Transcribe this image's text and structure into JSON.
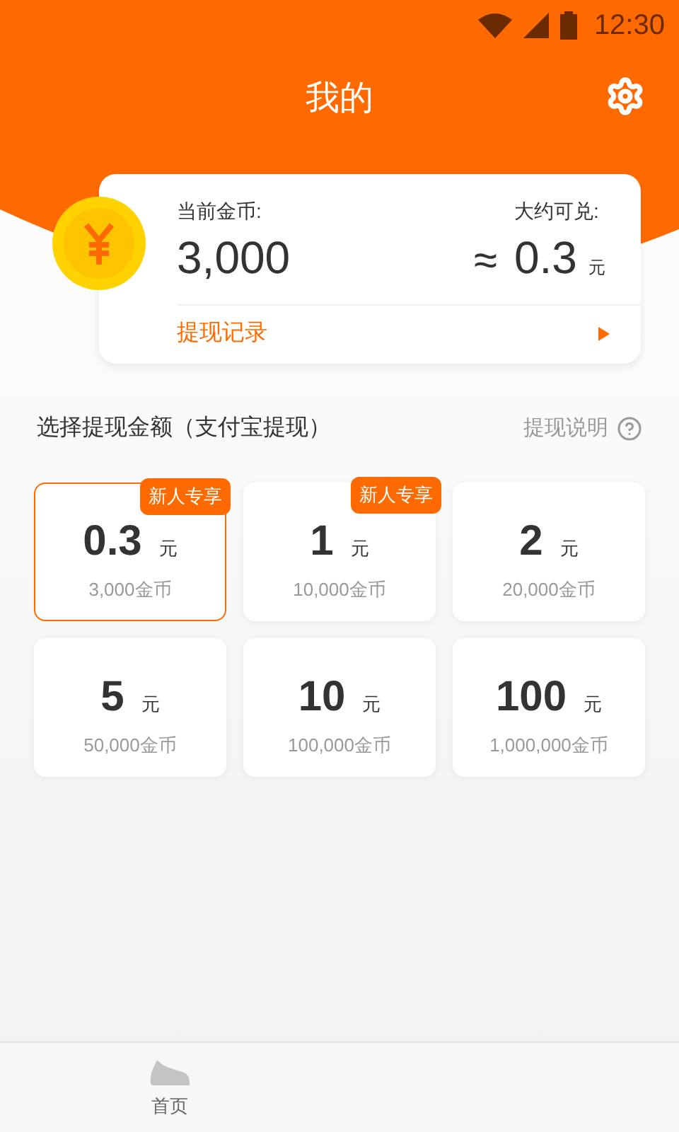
{
  "status_bar": {
    "time": "12:30"
  },
  "header": {
    "title": "我的"
  },
  "balance_card": {
    "coins_label": "当前金币:",
    "coins": "3,000",
    "approx_sign": "≈",
    "value_label": "大约可兑:",
    "value": "0.3",
    "value_unit": "元",
    "history_link": "提现记录"
  },
  "section": {
    "title": "选择提现金额（支付宝提现）",
    "help_link": "提现说明"
  },
  "options": [
    {
      "amount": "0.3",
      "unit": "元",
      "coins": "3,000金币",
      "badge": "新人专享",
      "selected": true
    },
    {
      "amount": "1",
      "unit": "元",
      "coins": "10,000金币",
      "badge": "新人专享",
      "selected": false
    },
    {
      "amount": "2",
      "unit": "元",
      "coins": "20,000金币",
      "selected": false
    },
    {
      "amount": "5",
      "unit": "元",
      "coins": "50,000金币",
      "selected": false
    },
    {
      "amount": "10",
      "unit": "元",
      "coins": "100,000金币",
      "selected": false
    },
    {
      "amount": "100",
      "unit": "元",
      "coins": "1,000,000金币",
      "selected": false
    }
  ],
  "bottom_nav": [
    {
      "label": "首页",
      "selected": false
    }
  ]
}
